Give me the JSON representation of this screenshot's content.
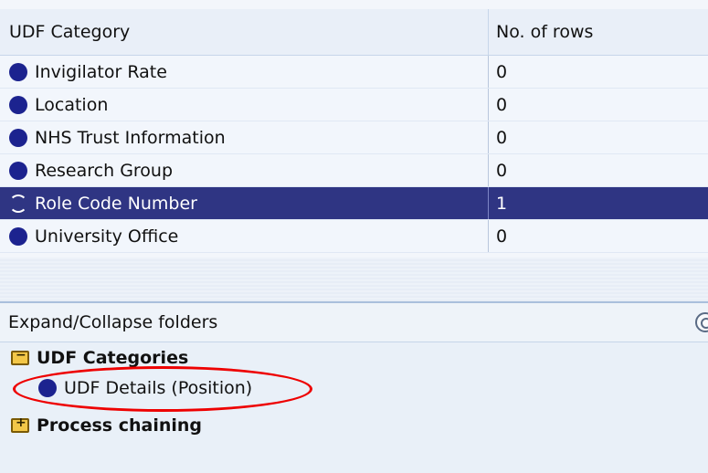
{
  "grid": {
    "headers": {
      "category": "UDF Category",
      "rows": "No. of rows"
    },
    "rows": [
      {
        "name": "Invigilator Rate",
        "count": "0"
      },
      {
        "name": "Location",
        "count": "0"
      },
      {
        "name": "NHS Trust Information",
        "count": "0"
      },
      {
        "name": "Research Group",
        "count": "0"
      },
      {
        "name": "Role Code Number",
        "count": "1",
        "selected": true
      },
      {
        "name": "University Office",
        "count": "0"
      }
    ]
  },
  "tree": {
    "header": "Expand/Collapse folders",
    "nodes": {
      "categories": "UDF Categories",
      "details": "UDF Details (Position)",
      "chaining": "Process chaining"
    }
  },
  "colors": {
    "selected_row": "#2f3583",
    "dot": "#1c238f",
    "highlight": "#e00000"
  },
  "icons": {
    "folder_expanded": "folder-minus-icon",
    "folder_collapsed": "folder-plus-icon",
    "search": "search-icon"
  }
}
